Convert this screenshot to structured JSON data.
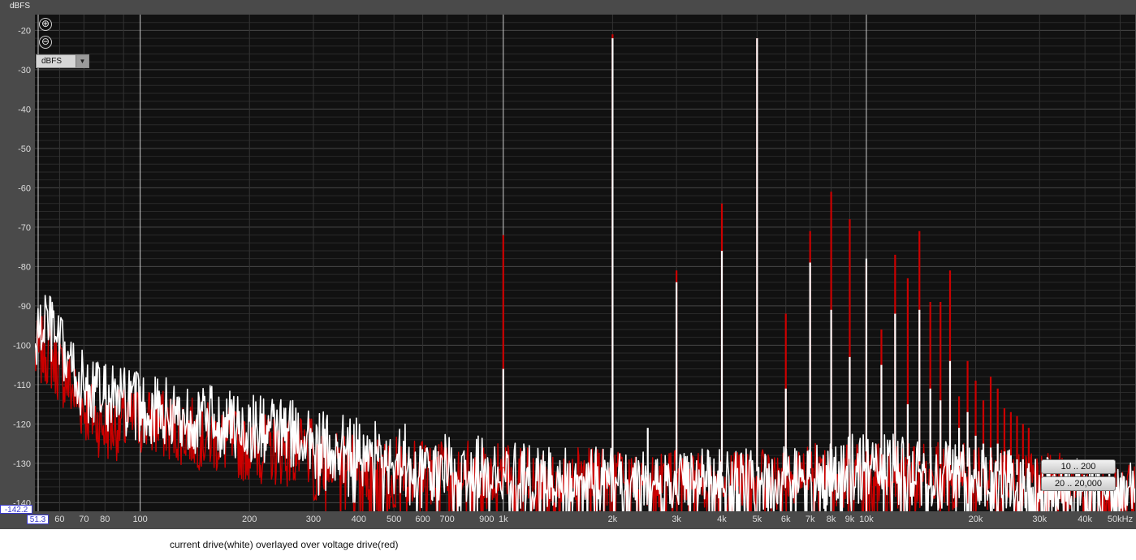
{
  "unit_title": "dBFS",
  "unit_selector": {
    "value": "dBFS",
    "arrow_icon": "triangle-down"
  },
  "zoom": {
    "zoom_in_glyph": "⊕",
    "zoom_out_glyph": "⊖"
  },
  "range_buttons": [
    "10 .. 200",
    "20 .. 20,000"
  ],
  "readouts": {
    "y_min": "-142.2",
    "x_min": "51.3"
  },
  "caption": "current drive(white) overlayed over voltage drive(red)",
  "colors": {
    "panel": "#4a4a4a",
    "plot_bg": "#111111",
    "grid": "#3a3a3a",
    "white_trace": "#ffffff",
    "red_trace": "#cc0000"
  },
  "chart_data": {
    "type": "line",
    "x_scale": "log",
    "xlim": [
      51.3,
      55000
    ],
    "ylim": [
      -142.2,
      -16
    ],
    "ylabel": "dBFS",
    "grid": true,
    "y_ticks": [
      -20,
      -30,
      -40,
      -50,
      -60,
      -70,
      -80,
      -90,
      -100,
      -110,
      -120,
      -130,
      -140
    ],
    "y_tick_labels": [
      "-20",
      "-30",
      "-40",
      "-50",
      "-60",
      "-70",
      "-80",
      "-90",
      "-100",
      "-110",
      "-120",
      "-130",
      "-140"
    ],
    "x_ticks": [
      {
        "value": 60,
        "label": "60"
      },
      {
        "value": 70,
        "label": "70"
      },
      {
        "value": 80,
        "label": "80"
      },
      {
        "value": 100,
        "label": "100"
      },
      {
        "value": 200,
        "label": "200"
      },
      {
        "value": 300,
        "label": "300"
      },
      {
        "value": 400,
        "label": "400"
      },
      {
        "value": 500,
        "label": "500"
      },
      {
        "value": 600,
        "label": "600"
      },
      {
        "value": 700,
        "label": "700"
      },
      {
        "value": 900,
        "label": "900"
      },
      {
        "value": 1000,
        "label": "1k"
      },
      {
        "value": 2000,
        "label": "2k"
      },
      {
        "value": 3000,
        "label": "3k"
      },
      {
        "value": 4000,
        "label": "4k"
      },
      {
        "value": 5000,
        "label": "5k"
      },
      {
        "value": 6000,
        "label": "6k"
      },
      {
        "value": 7000,
        "label": "7k"
      },
      {
        "value": 8000,
        "label": "8k"
      },
      {
        "value": 9000,
        "label": "9k"
      },
      {
        "value": 10000,
        "label": "10k"
      },
      {
        "value": 20000,
        "label": "20k"
      },
      {
        "value": 30000,
        "label": "30k"
      },
      {
        "value": 40000,
        "label": "40k"
      },
      {
        "value": 50000,
        "label": "50kHz"
      }
    ],
    "series": [
      {
        "color": "#cc0000",
        "noise_floor": [
          [
            51.3,
            -103
          ],
          [
            55,
            -101
          ],
          [
            60,
            -106
          ],
          [
            70,
            -116
          ],
          [
            80,
            -121
          ],
          [
            100,
            -119
          ],
          [
            150,
            -123
          ],
          [
            200,
            -126
          ],
          [
            400,
            -129
          ],
          [
            1000,
            -132
          ],
          [
            2000,
            -133
          ],
          [
            5000,
            -132
          ],
          [
            10000,
            -130
          ],
          [
            20000,
            -131
          ],
          [
            30000,
            -133
          ],
          [
            55000,
            -135
          ]
        ],
        "peaks": [
          [
            1000,
            -72
          ],
          [
            2000,
            -21
          ],
          [
            3000,
            -81
          ],
          [
            4000,
            -64
          ],
          [
            5000,
            -22
          ],
          [
            6000,
            -92
          ],
          [
            7000,
            -71
          ],
          [
            8000,
            -61
          ],
          [
            9000,
            -68
          ],
          [
            10000,
            -79
          ],
          [
            11000,
            -96
          ],
          [
            12000,
            -77
          ],
          [
            13000,
            -83
          ],
          [
            14000,
            -71
          ],
          [
            15000,
            -89
          ],
          [
            16000,
            -89
          ],
          [
            17000,
            -81
          ],
          [
            18000,
            -113
          ],
          [
            19000,
            -104
          ],
          [
            20000,
            -109
          ],
          [
            21000,
            -114
          ],
          [
            22000,
            -108
          ],
          [
            23000,
            -111
          ],
          [
            24000,
            -116
          ],
          [
            25000,
            -117
          ],
          [
            26000,
            -118
          ],
          [
            27000,
            -120
          ],
          [
            28000,
            -121
          ]
        ]
      },
      {
        "color": "#ffffff",
        "noise_floor": [
          [
            51.3,
            -100
          ],
          [
            55,
            -93
          ],
          [
            60,
            -101
          ],
          [
            70,
            -111
          ],
          [
            80,
            -113
          ],
          [
            100,
            -116
          ],
          [
            150,
            -119
          ],
          [
            200,
            -121
          ],
          [
            400,
            -125
          ],
          [
            1000,
            -131
          ],
          [
            2000,
            -133
          ],
          [
            5000,
            -132
          ],
          [
            8000,
            -131
          ],
          [
            10000,
            -127
          ],
          [
            15000,
            -130
          ],
          [
            20000,
            -131
          ],
          [
            30000,
            -134
          ],
          [
            55000,
            -136
          ]
        ],
        "peaks": [
          [
            1000,
            -106
          ],
          [
            2000,
            -22
          ],
          [
            2500,
            -121
          ],
          [
            3000,
            -84
          ],
          [
            4000,
            -76
          ],
          [
            5000,
            -22
          ],
          [
            6000,
            -111
          ],
          [
            7000,
            -79
          ],
          [
            8000,
            -91
          ],
          [
            9000,
            -103
          ],
          [
            10000,
            -78
          ],
          [
            11000,
            -105
          ],
          [
            12000,
            -92
          ],
          [
            13000,
            -115
          ],
          [
            14000,
            -91
          ],
          [
            15000,
            -111
          ],
          [
            16000,
            -114
          ],
          [
            17000,
            -104
          ],
          [
            18000,
            -121
          ],
          [
            19000,
            -117
          ],
          [
            20000,
            -123
          ],
          [
            21000,
            -125
          ],
          [
            22000,
            -126
          ],
          [
            23000,
            -125
          ],
          [
            24000,
            -127
          ],
          [
            25000,
            -128
          ],
          [
            26000,
            -129
          ],
          [
            27000,
            -129
          ],
          [
            28000,
            -130
          ]
        ]
      }
    ]
  }
}
